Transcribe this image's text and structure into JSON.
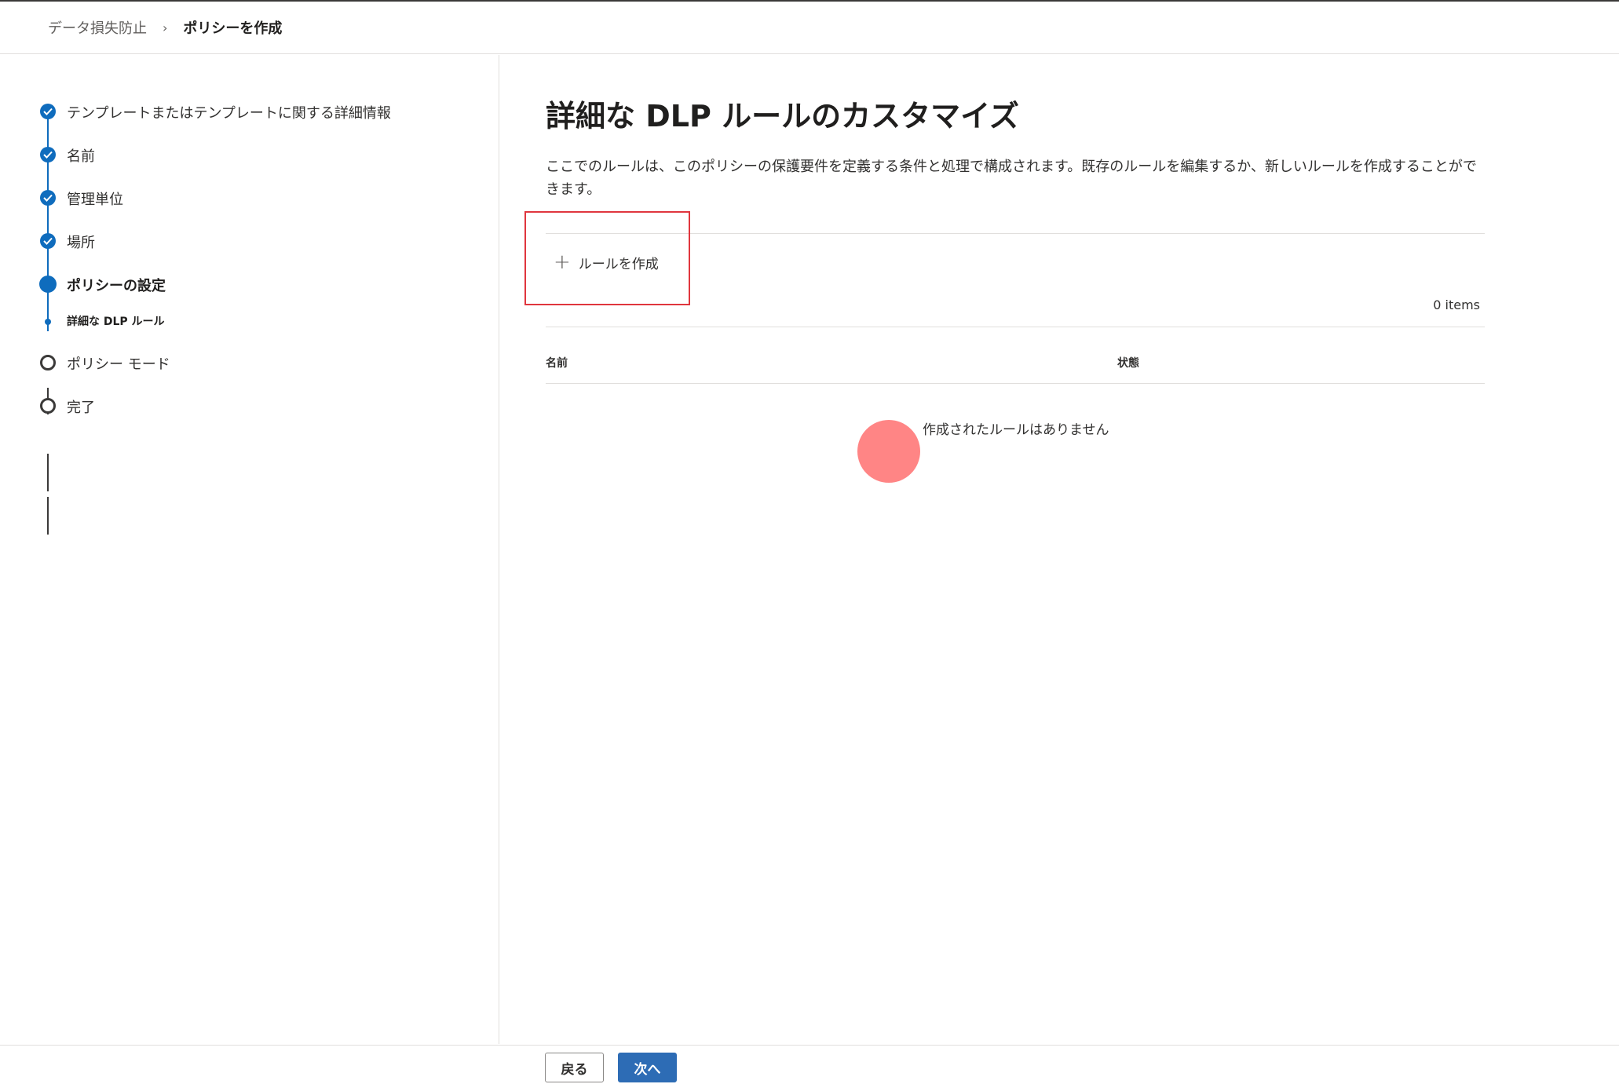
{
  "breadcrumb": {
    "parent": "データ損失防止",
    "separator": "›",
    "current": "ポリシーを作成"
  },
  "steps": [
    {
      "label": "テンプレートまたはテンプレートに関する詳細情報",
      "state": "done"
    },
    {
      "label": "名前",
      "state": "done"
    },
    {
      "label": "管理単位",
      "state": "done"
    },
    {
      "label": "場所",
      "state": "done"
    },
    {
      "label": "ポリシーの設定",
      "state": "current"
    },
    {
      "label": "詳細な DLP ルール",
      "state": "current-sub"
    },
    {
      "label": "ポリシー モード",
      "state": "todo"
    },
    {
      "label": "完了",
      "state": "todo"
    }
  ],
  "main": {
    "title": "詳細な DLP ルールのカスタマイズ",
    "description": "ここでのルールは、このポリシーの保護要件を定義する条件と処理で構成されます。既存のルールを編集するか、新しいルールを作成することができます。",
    "add_rule_label": "ルールを作成",
    "add_rule_icon": "plus-icon",
    "items_count": "0 items",
    "columns": [
      "名前",
      "状態"
    ],
    "empty_message": "作成されたルールはありません"
  },
  "footer": {
    "back_label": "戻る",
    "next_label": "次へ"
  },
  "colors": {
    "accent": "#0f6cbd",
    "primary_button": "#2d6cb5",
    "highlight_box": "#e0363e",
    "cursor_indicator": "#ff7b7b"
  }
}
